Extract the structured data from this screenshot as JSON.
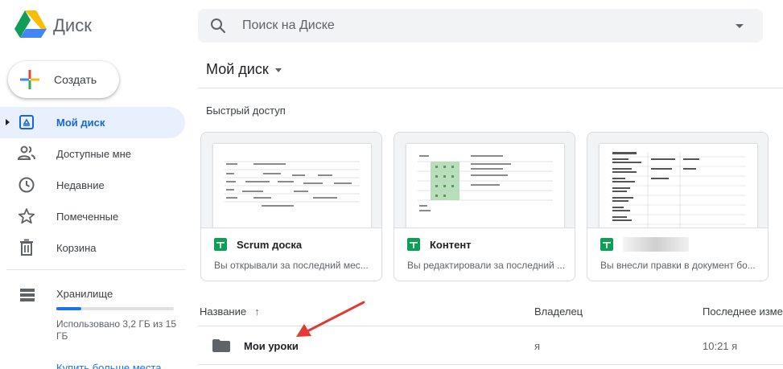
{
  "app": {
    "title": "Диск"
  },
  "search": {
    "placeholder": "Поиск на Диске"
  },
  "sidebar": {
    "create_label": "Создать",
    "items": [
      {
        "label": "Мой диск",
        "icon": "my-drive-icon",
        "active": true
      },
      {
        "label": "Доступные мне",
        "icon": "people-icon"
      },
      {
        "label": "Недавние",
        "icon": "clock-icon"
      },
      {
        "label": "Помеченные",
        "icon": "star-icon"
      },
      {
        "label": "Корзина",
        "icon": "trash-icon"
      }
    ],
    "storage": {
      "label": "Хранилище",
      "used_text": "Использовано 3,2 ГБ из 15 ГБ",
      "used_fraction": 0.213,
      "buy_more": "Купить больше места"
    }
  },
  "main": {
    "title": "Мой диск",
    "quick_access_title": "Быстрый доступ",
    "quick_access": [
      {
        "name": "Scrum доска",
        "note": "Вы открывали за последний мес...",
        "icon": "sheets-icon"
      },
      {
        "name": "Контент",
        "note": "Вы редактировали за последний ...",
        "icon": "sheets-icon"
      },
      {
        "name": "",
        "note": "Вы внесли правки в документ бо...",
        "icon": "sheets-icon"
      }
    ],
    "table": {
      "headers": {
        "name": "Название",
        "owner": "Владелец",
        "modified": "Последнее изме"
      },
      "rows": [
        {
          "name": "Мои уроки",
          "owner": "я",
          "modified": "10:21 я",
          "icon": "folder-icon"
        }
      ]
    }
  },
  "colors": {
    "accent": "#1a73e8",
    "active_bg": "#e8f0fe",
    "sheets_green": "#0f9d58",
    "annotation_red": "#e53935"
  }
}
